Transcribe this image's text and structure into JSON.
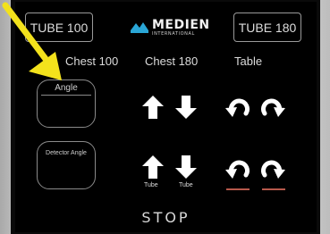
{
  "panel": {
    "tube_left": "TUBE 100",
    "tube_right": "TUBE 180",
    "logo_name": "MEDIEN",
    "logo_sub": "INTERNATIONAL"
  },
  "columns": {
    "chest100": "Chest 100",
    "chest180": "Chest 180",
    "table": "Table"
  },
  "buttons": {
    "angle": "Angle",
    "detector_angle": "Detector Angle",
    "tube_up": "Tube",
    "tube_down": "Tube",
    "stop": "STOP"
  },
  "icons": {
    "up": "arrow-up-icon",
    "down": "arrow-down-icon",
    "rotate_ccw": "rotate-counterclockwise-icon",
    "rotate_cw": "rotate-clockwise-icon"
  },
  "colors": {
    "pointer": "#f3e21c",
    "screen": "#000000",
    "text": "#e6e6e6",
    "underline": "#b6584b"
  }
}
